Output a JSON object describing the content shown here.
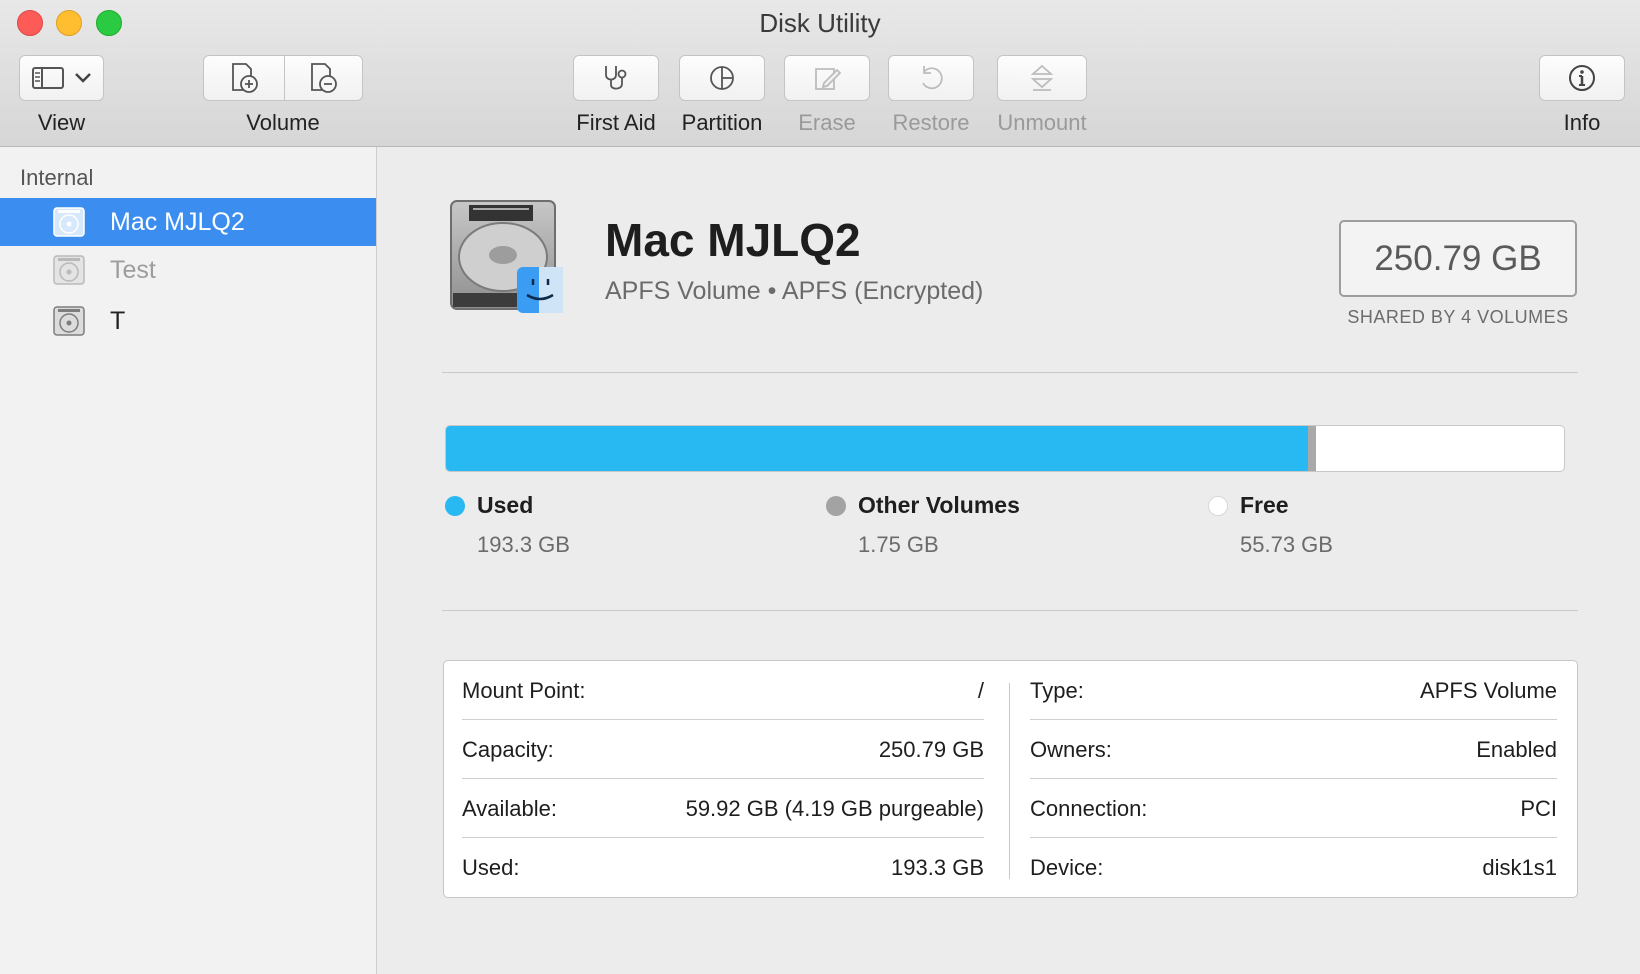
{
  "window": {
    "title": "Disk Utility"
  },
  "toolbar": {
    "view_label": "View",
    "volume_label": "Volume",
    "first_aid_label": "First Aid",
    "partition_label": "Partition",
    "erase_label": "Erase",
    "restore_label": "Restore",
    "unmount_label": "Unmount",
    "info_label": "Info"
  },
  "sidebar": {
    "section": "Internal",
    "items": [
      {
        "label": "Mac MJLQ2",
        "selected": true
      },
      {
        "label": "Test",
        "dimmed": true
      },
      {
        "label": "T"
      }
    ]
  },
  "volume": {
    "name": "Mac MJLQ2",
    "subtitle": "APFS Volume • APFS (Encrypted)",
    "size": "250.79 GB",
    "size_caption": "SHARED BY 4 VOLUMES"
  },
  "usage": {
    "total_gb": 250.79,
    "used_gb": 193.3,
    "other_gb": 1.75,
    "free_gb": 55.73,
    "colors": {
      "used": "#28b8f2",
      "other": "#a9a9a9",
      "free": "#ffffff"
    },
    "legend": [
      {
        "name": "Used",
        "value": "193.3 GB"
      },
      {
        "name": "Other Volumes",
        "value": "1.75 GB"
      },
      {
        "name": "Free",
        "value": "55.73 GB"
      }
    ]
  },
  "info": {
    "left": [
      {
        "key": "Mount Point:",
        "value": "/"
      },
      {
        "key": "Capacity:",
        "value": "250.79 GB"
      },
      {
        "key": "Available:",
        "value": "59.92 GB (4.19 GB purgeable)"
      },
      {
        "key": "Used:",
        "value": "193.3 GB"
      }
    ],
    "right": [
      {
        "key": "Type:",
        "value": "APFS Volume"
      },
      {
        "key": "Owners:",
        "value": "Enabled"
      },
      {
        "key": "Connection:",
        "value": "PCI"
      },
      {
        "key": "Device:",
        "value": "disk1s1"
      }
    ]
  },
  "icons": {
    "view": "sidebar-toggle-icon",
    "chevron": "chevron-down-icon",
    "add_volume": "add-volume-icon",
    "remove_volume": "remove-volume-icon",
    "first_aid": "stethoscope-icon",
    "partition": "pie-chart-icon",
    "erase": "pencil-icon",
    "restore": "undo-arrow-icon",
    "unmount": "eject-icon",
    "info": "info-icon",
    "disk": "hard-drive-icon"
  }
}
